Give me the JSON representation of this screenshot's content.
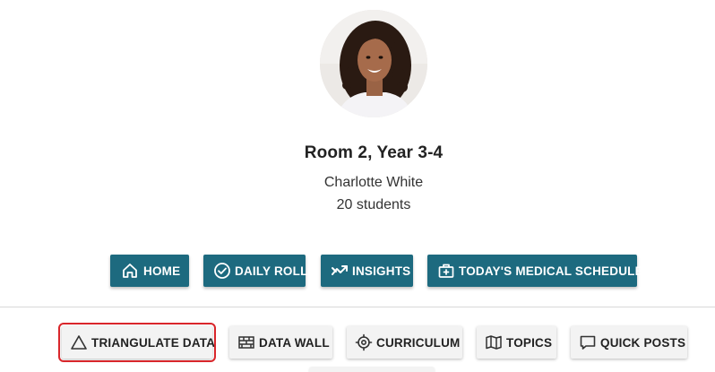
{
  "profile": {
    "room_title": "Room 2, Year 3-4",
    "teacher_name": "Charlotte White",
    "student_count": "20 students"
  },
  "primary_nav": [
    {
      "label": "HOME",
      "icon": "home-icon"
    },
    {
      "label": "DAILY ROLL",
      "icon": "check-circle-icon"
    },
    {
      "label": "INSIGHTS",
      "icon": "insights-icon"
    },
    {
      "label": "TODAY'S MEDICAL SCHEDULE",
      "icon": "medical-kit-icon"
    }
  ],
  "secondary_nav": [
    {
      "label": "TRIANGULATE DATA",
      "icon": "triangle-icon",
      "selected": true
    },
    {
      "label": "DATA WALL",
      "icon": "brick-wall-icon"
    },
    {
      "label": "CURRICULUM",
      "icon": "target-icon"
    },
    {
      "label": "TOPICS",
      "icon": "map-icon"
    },
    {
      "label": "QUICK POSTS",
      "icon": "comment-icon"
    }
  ],
  "colors": {
    "primary_button": "#1d6a7f",
    "secondary_button": "#f3f3f3",
    "selection_outline": "#d9262b"
  }
}
